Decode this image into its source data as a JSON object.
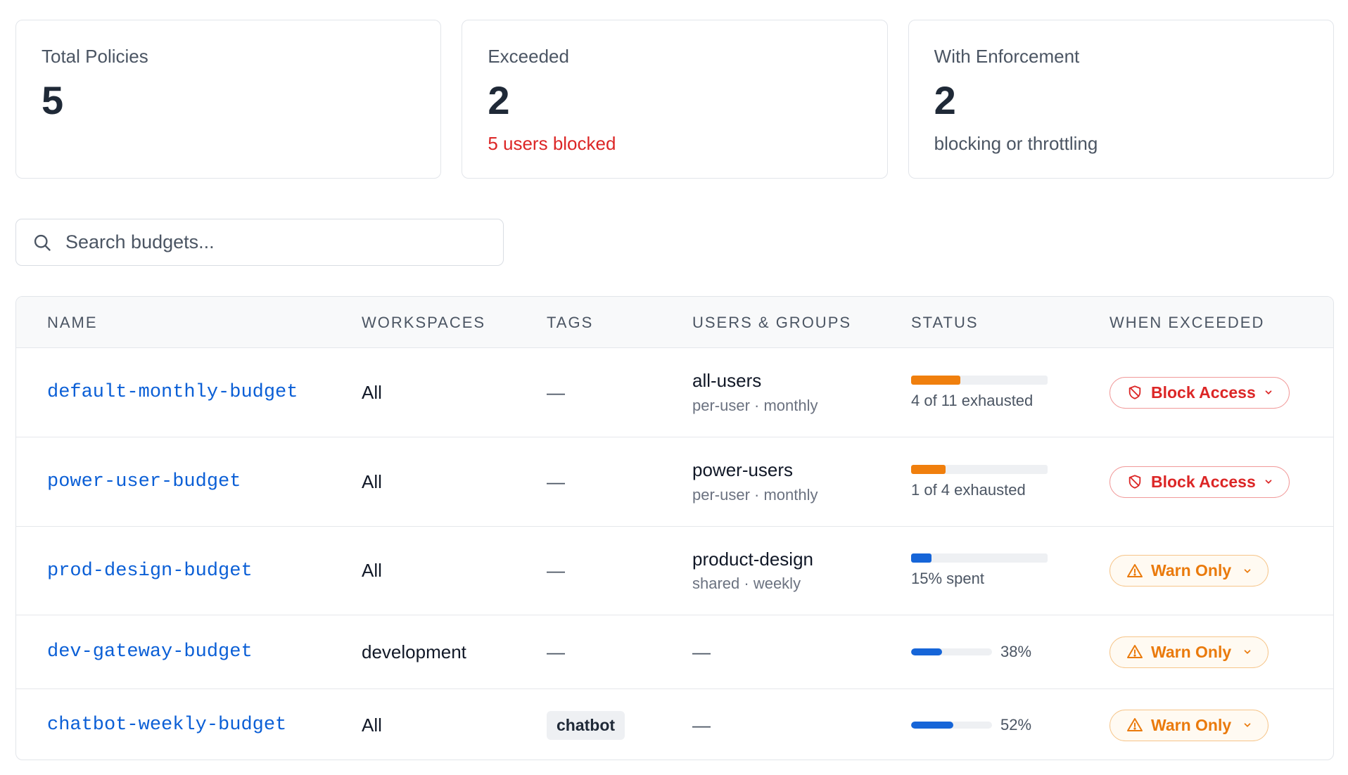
{
  "stats": [
    {
      "label": "Total Policies",
      "value": "5",
      "sub": ""
    },
    {
      "label": "Exceeded",
      "value": "2",
      "sub": "5 users blocked"
    },
    {
      "label": "With Enforcement",
      "value": "2",
      "sub": "blocking or throttling"
    }
  ],
  "search": {
    "placeholder": "Search budgets..."
  },
  "table": {
    "headers": [
      "NAME",
      "WORKSPACES",
      "TAGS",
      "USERS & GROUPS",
      "STATUS",
      "WHEN EXCEEDED"
    ],
    "rows": [
      {
        "name": "default-monthly-budget",
        "workspaces": "All",
        "tags": "—",
        "users_main": "all-users",
        "users_sub": "per-user · monthly",
        "status_caption": "4 of 11 exhausted",
        "status_fraction": 0.36,
        "status_color": "#f07f0d",
        "action": "Block Access",
        "action_type": "block"
      },
      {
        "name": "power-user-budget",
        "workspaces": "All",
        "tags": "—",
        "users_main": "power-users",
        "users_sub": "per-user · monthly",
        "status_caption": "1 of 4 exhausted",
        "status_fraction": 0.25,
        "status_color": "#f07f0d",
        "action": "Block Access",
        "action_type": "block"
      },
      {
        "name": "prod-design-budget",
        "workspaces": "All",
        "tags": "—",
        "users_main": "product-design",
        "users_sub": "shared · weekly",
        "status_caption": "15% spent",
        "status_fraction": 0.15,
        "status_color": "#1665d8",
        "action": "Warn Only",
        "action_type": "warn"
      },
      {
        "name": "dev-gateway-budget",
        "workspaces": "development",
        "tags": "—",
        "users_main": "—",
        "users_sub": "",
        "status_caption": "38%",
        "status_fraction": 0.38,
        "status_color": "#1665d8",
        "action": "Warn Only",
        "action_type": "warn"
      },
      {
        "name": "chatbot-weekly-budget",
        "workspaces": "All",
        "tags": "chatbot",
        "users_main": "—",
        "users_sub": "",
        "status_caption": "52%",
        "status_fraction": 0.52,
        "status_color": "#1665d8",
        "action": "Warn Only",
        "action_type": "warn"
      }
    ]
  },
  "icons": {
    "search": "search-icon",
    "block": "shield-off-icon",
    "warn": "warning-triangle-icon",
    "chevron": "chevron-down-icon"
  },
  "colors": {
    "link": "#0b5fd6",
    "danger": "#dc2626",
    "warning": "#ea7a0c",
    "orange_bar": "#f07f0d",
    "blue_bar": "#1665d8"
  }
}
